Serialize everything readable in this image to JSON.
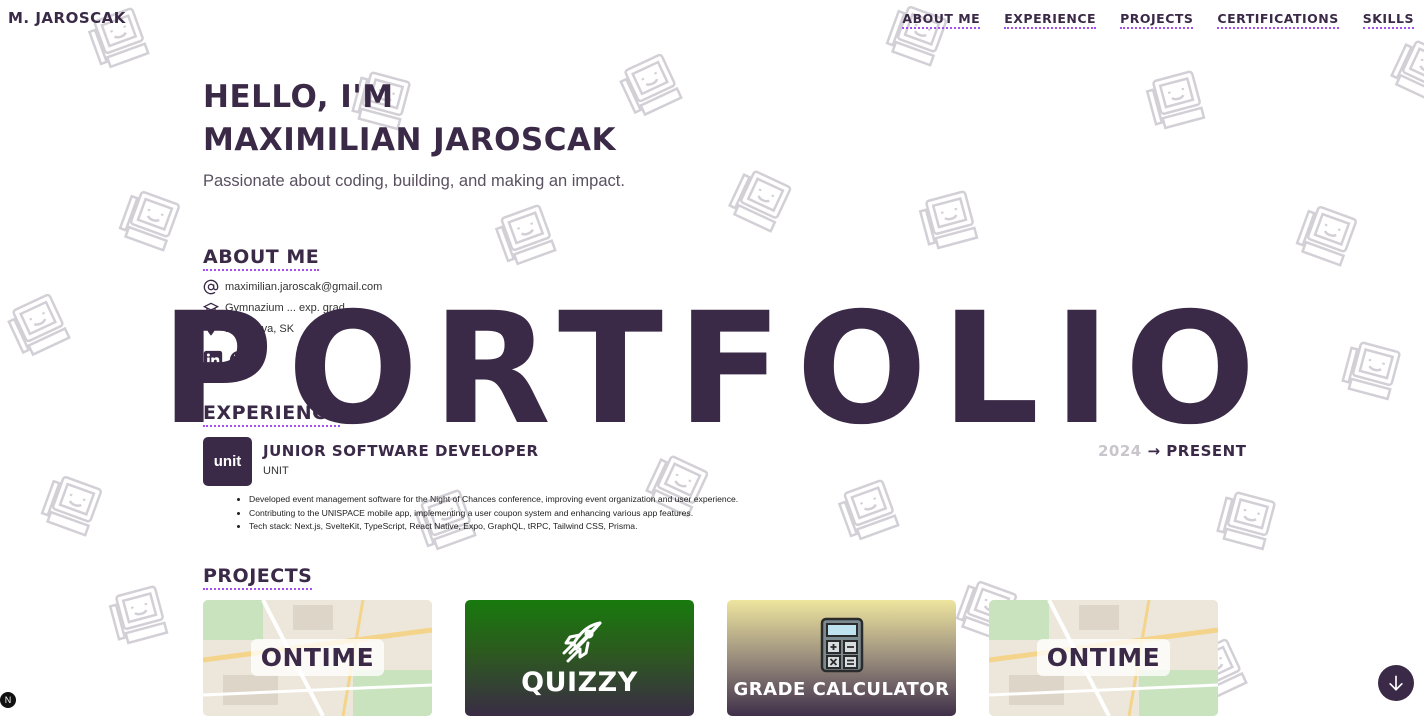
{
  "brand": "M. JAROSCAK",
  "nav": [
    "ABOUT ME",
    "EXPERIENCE",
    "PROJECTS",
    "CERTIFICATIONS",
    "SKILLS"
  ],
  "hero": {
    "line1": "HELLO, I'M",
    "line2": "MAXIMILIAN JAROSCAK",
    "subtitle": "Passionate about coding, building, and making an impact."
  },
  "about": {
    "title": "ABOUT ME",
    "email": "maximilian.jaroscak@gmail.com",
    "education": "Gymnazium ... exp. grad",
    "location": "Bratislava, SK"
  },
  "experience": {
    "title": "EXPERIENCE",
    "logo_text": "unit",
    "role": "JUNIOR SOFTWARE DEVELOPER",
    "company": "UNIT",
    "date_start": "2024",
    "date_arrow": "→",
    "date_end": "PRESENT",
    "bullets": [
      "Developed event management software for the Night of Chances conference, improving event organization and user experience.",
      "Contributing to the UNISPACE mobile app, implementing a user coupon system and enhancing various app features.",
      "Tech stack: Next.js, SvelteKit, TypeScript, React Native, Expo, GraphQL, tRPC, Tailwind CSS, Prisma."
    ]
  },
  "projects": {
    "title": "PROJECTS",
    "cards": [
      "ONTIME",
      "QUIZZY",
      "GRADE CALCULATOR",
      "ONTIME"
    ]
  },
  "overlay": "PORTFOLIO",
  "dev_badge": "N",
  "icons": {
    "doodle": "retro-computer-icon",
    "email": "at-sign-icon",
    "education": "graduation-cap-icon",
    "location": "map-pin-icon",
    "linkedin": "linkedin-icon",
    "github": "github-icon",
    "quiz": "rocket-icon",
    "grade": "calculator-icon",
    "fab": "arrow-down-icon"
  },
  "colors": {
    "primary": "#3b2a47",
    "accent": "#a64ff0"
  }
}
